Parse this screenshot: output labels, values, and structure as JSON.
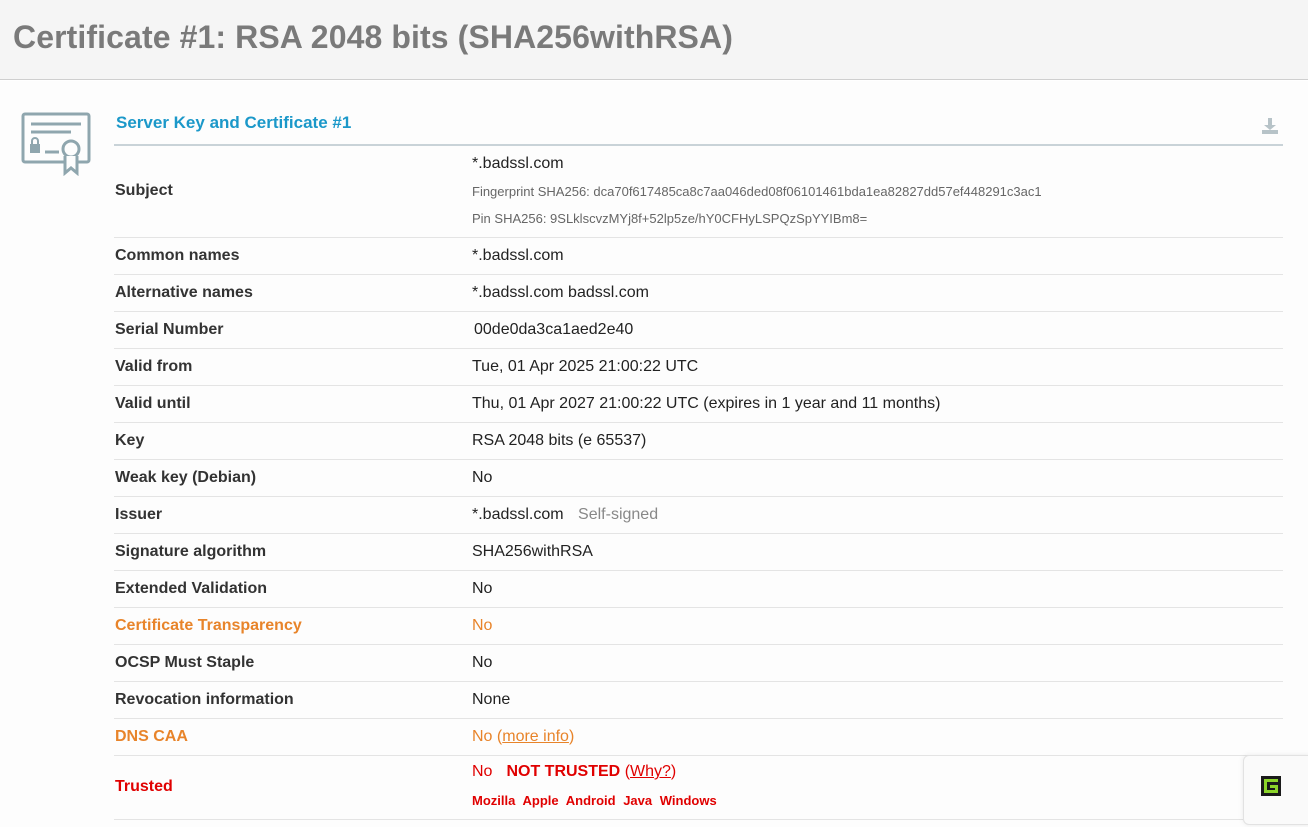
{
  "page": {
    "title": "Certificate #1: RSA 2048 bits (SHA256withRSA)"
  },
  "section": {
    "title": "Server Key and Certificate #1",
    "icons": {
      "certificate": "certificate-icon",
      "download": "download-icon"
    }
  },
  "subject": {
    "label": "Subject",
    "value": "*.badssl.com",
    "fingerprint": "Fingerprint SHA256: dca70f617485ca8c7aa046ded08f06101461bda1ea82827dd57ef448291c3ac1",
    "pin": "Pin SHA256: 9SLklscvzMYj8f+52lp5ze/hY0CFHyLSPQzSpYYIBm8="
  },
  "rows": {
    "common_names": {
      "label": "Common names",
      "value": "*.badssl.com"
    },
    "alternative_names": {
      "label": "Alternative names",
      "value": "*.badssl.com badssl.com"
    },
    "serial_number": {
      "label": "Serial Number",
      "value": "00de0da3ca1aed2e40"
    },
    "valid_from": {
      "label": "Valid from",
      "value": "Tue, 01 Apr 2025 21:00:22 UTC"
    },
    "valid_until": {
      "label": "Valid until",
      "value": "Thu, 01 Apr 2027 21:00:22 UTC (expires in 1 year and 11 months)"
    },
    "key": {
      "label": "Key",
      "value": "RSA 2048 bits (e 65537)"
    },
    "weak_key": {
      "label": "Weak key (Debian)",
      "value": "No"
    },
    "issuer": {
      "label": "Issuer",
      "value": "*.badssl.com",
      "note": "Self-signed"
    },
    "signature_algorithm": {
      "label": "Signature algorithm",
      "value": "SHA256withRSA"
    },
    "extended_validation": {
      "label": "Extended Validation",
      "value": "No"
    },
    "certificate_transparency": {
      "label": "Certificate Transparency",
      "value": "No"
    },
    "ocsp_must_staple": {
      "label": "OCSP Must Staple",
      "value": "No"
    },
    "revocation_information": {
      "label": "Revocation information",
      "value": "None"
    },
    "dns_caa": {
      "label": "DNS CAA",
      "value": "No",
      "link_open": "(",
      "link": "more info",
      "link_close": ")"
    }
  },
  "trusted": {
    "label": "Trusted",
    "value": "No",
    "status": "NOT TRUSTED",
    "why_open": "(",
    "why": "Why?",
    "why_close": ")",
    "stores": [
      "Mozilla",
      "Apple",
      "Android",
      "Java",
      "Windows"
    ]
  },
  "colors": {
    "accent": "#1b98c9",
    "warning": "#e8842a",
    "error": "#e00000",
    "title_gray": "#7a7a7a"
  },
  "widget": {
    "icon": "app-widget-icon"
  }
}
